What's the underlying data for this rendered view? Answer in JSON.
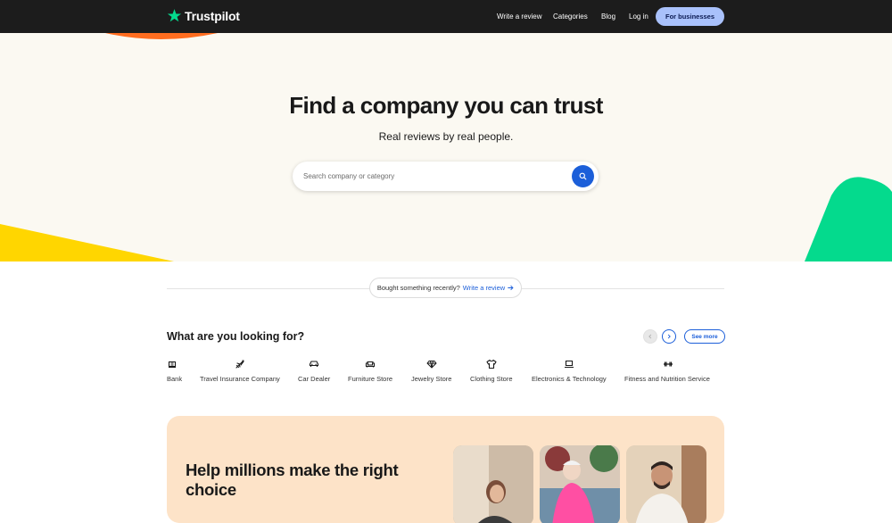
{
  "brand": {
    "name": "Trustpilot",
    "star_color": "#04da8d"
  },
  "nav": {
    "write_review": "Write a review",
    "categories": "Categories",
    "blog": "Blog",
    "login": "Log in",
    "for_businesses": "For businesses"
  },
  "hero": {
    "title": "Find a company you can trust",
    "subtitle": "Real reviews by real people.",
    "search_placeholder": "Search company or category"
  },
  "recent": {
    "prompt": "Bought something recently?",
    "link": "Write a review"
  },
  "categories": {
    "title": "What are you looking for?",
    "see_more": "See more",
    "items": [
      {
        "label": "Bank",
        "icon": "bank-icon"
      },
      {
        "label": "Travel Insurance Company",
        "icon": "airplane-icon"
      },
      {
        "label": "Car Dealer",
        "icon": "car-icon"
      },
      {
        "label": "Furniture Store",
        "icon": "sofa-icon"
      },
      {
        "label": "Jewelry Store",
        "icon": "diamond-icon"
      },
      {
        "label": "Clothing Store",
        "icon": "shirt-icon"
      },
      {
        "label": "Electronics & Technology",
        "icon": "laptop-icon"
      },
      {
        "label": "Fitness and Nutrition Service",
        "icon": "dumbbell-icon"
      }
    ]
  },
  "promo": {
    "title": "Help millions make the right choice"
  },
  "colors": {
    "header_bg": "#1c1c1c",
    "hero_bg": "#fbf9f2",
    "accent_blue": "#1c5fd9",
    "business_button": "#a9c1fb",
    "promo_bg": "#fde3c8",
    "shape_orange": "#ff6d1f",
    "shape_yellow": "#ffd600",
    "shape_green": "#04da8d"
  }
}
